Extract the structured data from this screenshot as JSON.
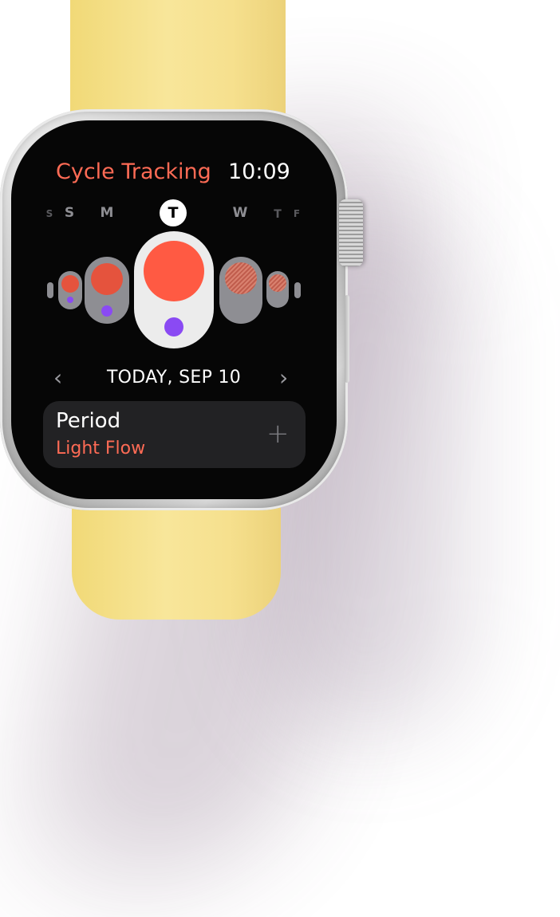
{
  "app": {
    "title": "Cycle Tracking",
    "time": "10:09"
  },
  "week_days": [
    {
      "label": "S"
    },
    {
      "label": "S"
    },
    {
      "label": "M"
    },
    {
      "label": "T",
      "today": true
    },
    {
      "label": "W"
    },
    {
      "label": "T"
    },
    {
      "label": "F"
    }
  ],
  "nav": {
    "prev_icon": "chevron-left-icon",
    "next_icon": "chevron-right-icon",
    "date_label": "TODAY, SEP 10"
  },
  "log_card": {
    "title": "Period",
    "value": "Light Flow",
    "add_icon": "plus-icon"
  },
  "colors": {
    "accent": "#ff6b55",
    "period": "#e5533d",
    "fertile": "#8a4af3",
    "band": "#f6e08e",
    "screen": "#000000"
  }
}
